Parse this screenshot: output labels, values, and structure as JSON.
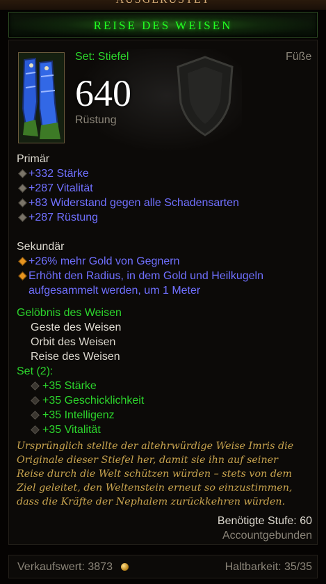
{
  "item": {
    "name_prefix": "AUSGERÜSTET",
    "name": "REISE DES WEISEN",
    "set_label": "Set: Stiefel",
    "slot": "Füße",
    "armor_value": "640",
    "armor_label": "Rüstung",
    "icon": "boots-icon"
  },
  "primary": {
    "heading": "Primär",
    "stats": [
      "+332 Stärke",
      "+287 Vitalität",
      "+83 Widerstand gegen alle Schadensarten",
      "+287 Rüstung"
    ]
  },
  "secondary": {
    "heading": "Sekundär",
    "stats": [
      "+26% mehr Gold von Gegnern",
      "Erhöht den Radius, in dem Gold und Heilkugeln",
      "aufgesammelt werden, um 1 Meter"
    ]
  },
  "set": {
    "name": "Gelöbnis des Weisen",
    "pieces": [
      "Geste des Weisen",
      "Orbit des Weisen",
      "Reise des Weisen"
    ],
    "bonus_heading": "Set (2):",
    "bonuses": [
      "+35 Stärke",
      "+35 Geschicklichkeit",
      "+35 Intelligenz",
      "+35 Vitalität"
    ]
  },
  "flavor": [
    "Ursprünglich stellte der altehrwürdige Weise Imris die",
    "Originale dieser Stiefel her, damit sie ihn auf seiner",
    "Reise durch die Welt schützen würden – stets von dem",
    "Ziel geleitet, den Weltenstein erneut so einzustimmen,",
    "dass die Kräfte der Nephalem zurückkehren würden."
  ],
  "requirements": {
    "level": "Benötigte Stufe: 60",
    "binding": "Accountgebunden"
  },
  "footer": {
    "sell_value": "Verkaufswert: 3873",
    "durability": "Haltbarkeit: 35/35"
  },
  "colors": {
    "set_green": "#2cd52c",
    "magic_blue": "#7070ff",
    "flavor_gold": "#c7a34e"
  }
}
